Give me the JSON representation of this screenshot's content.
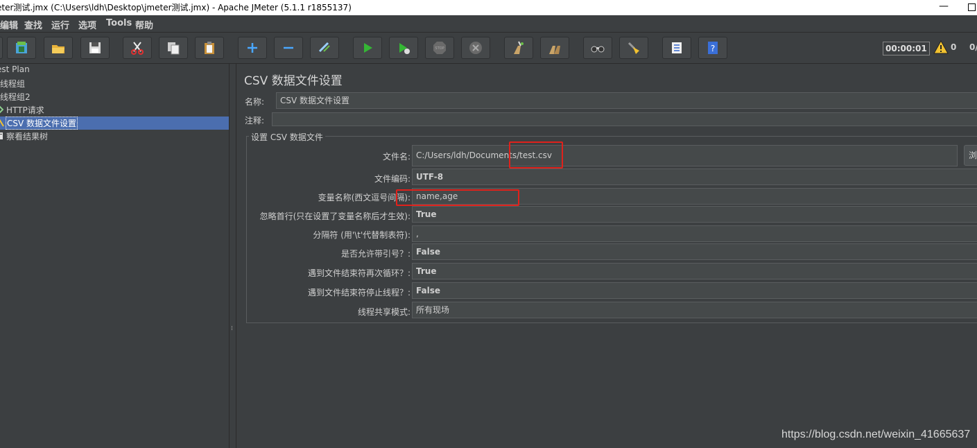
{
  "window": {
    "title": "eter测试.jmx (C:\\Users\\ldh\\Desktop\\jmeter测试.jmx) - Apache JMeter (5.1.1 r1855137)",
    "minimize": "—"
  },
  "menu": [
    "编辑",
    "查找",
    "运行",
    "选项",
    "Tools",
    "帮助"
  ],
  "toolbar": {
    "buttons": [
      "template-icon",
      "open-icon",
      "save-icon",
      "cut-icon",
      "copy-icon",
      "paste-icon",
      "expand-icon",
      "collapse-icon",
      "toggle-icon",
      "start-icon",
      "start-no-pause-icon",
      "stop-icon",
      "shutdown-icon",
      "clear-icon",
      "clear-all-icon",
      "search-icon",
      "reset-search-icon",
      "function-helper-icon",
      "help-icon"
    ],
    "timer": "00:00:01",
    "warning_count": "0",
    "threads": "0/"
  },
  "tree": {
    "items": [
      {
        "label": "est Plan",
        "icon": "test-plan-icon"
      },
      {
        "label": "线程组",
        "icon": "thread-group-icon"
      },
      {
        "label": "线程组2",
        "icon": "thread-group-icon"
      },
      {
        "label": "HTTP请求",
        "icon": "http-sampler-icon"
      },
      {
        "label": "CSV 数据文件设置",
        "icon": "csv-config-icon"
      },
      {
        "label": "察看结果树",
        "icon": "listener-icon"
      }
    ],
    "selected_index": 4
  },
  "panel": {
    "title": "CSV 数据文件设置",
    "name_label": "名称:",
    "name_value": "CSV 数据文件设置",
    "comment_label": "注释:",
    "comment_value": "",
    "group_title": "设置 CSV 数据文件",
    "fields": [
      {
        "label": "文件名:",
        "value": "C:/Users/ldh/Documents/test.csv"
      },
      {
        "label": "文件编码:",
        "value": "UTF-8"
      },
      {
        "label": "变量名称(西文逗号间隔):",
        "value": "name,age"
      },
      {
        "label": "忽略首行(只在设置了变量名称后才生效):",
        "value": "True"
      },
      {
        "label": "分隔符 (用'\\t'代替制表符):",
        "value": ","
      },
      {
        "label": "是否允许带引号？:",
        "value": "False"
      },
      {
        "label": "遇到文件结束符再次循环？:",
        "value": "True"
      },
      {
        "label": "遇到文件结束符停止线程？:",
        "value": "False"
      },
      {
        "label": "线程共享模式:",
        "value": "所有现场"
      }
    ],
    "browse_label": "浏览..."
  },
  "watermark": "https://blog.csdn.net/weixin_41665637"
}
